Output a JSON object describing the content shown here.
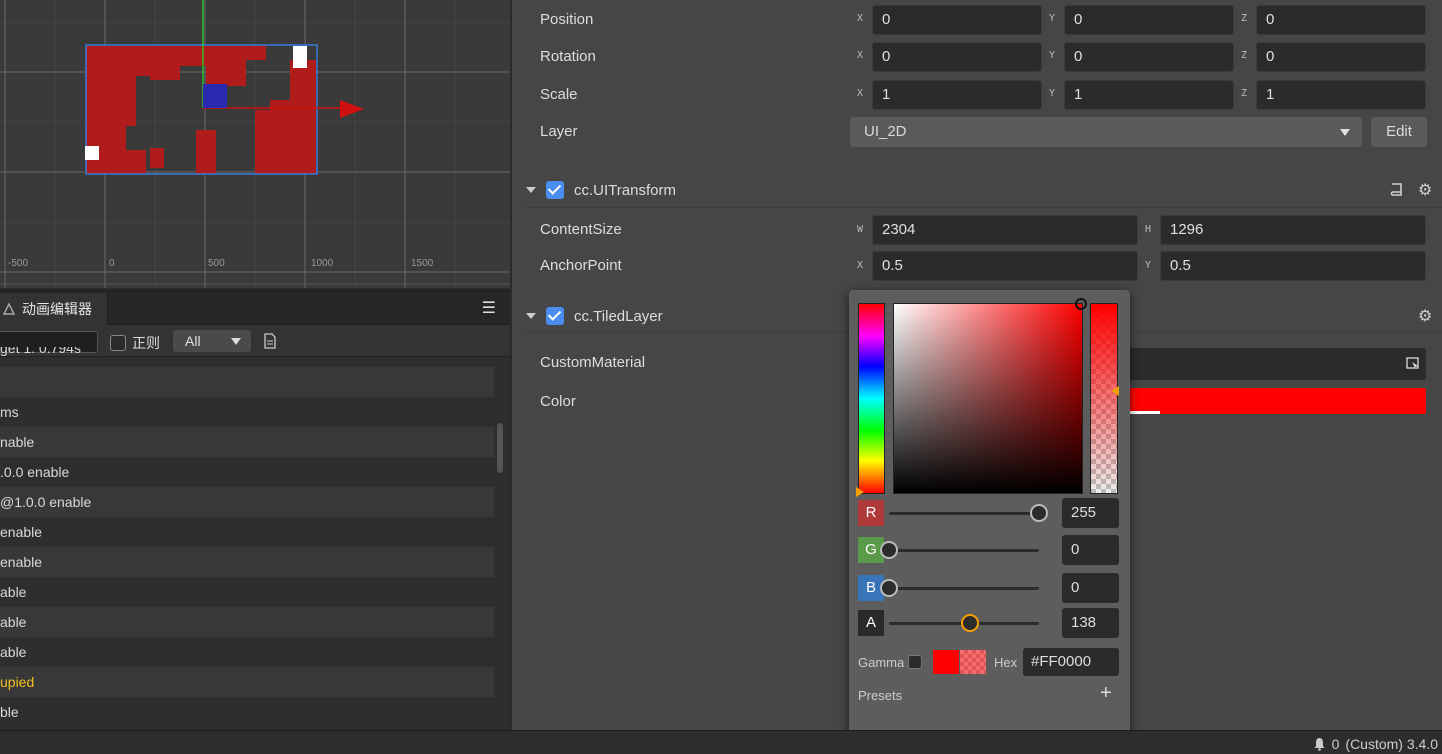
{
  "scene": {
    "ruler_labels": [
      "-500",
      "0",
      "500",
      "1000",
      "1500"
    ]
  },
  "anim_panel": {
    "tab_label": "动画编辑器",
    "menu_icon": "hamburger-icon",
    "filter_check_label": "正则",
    "filter_select": "All",
    "rows": [
      {
        "text": "get 1: 0.794s",
        "style": "normal"
      },
      {
        "text": "",
        "style": "alt"
      },
      {
        "text": "ms",
        "style": "normal"
      },
      {
        "text": "nable",
        "style": "alt"
      },
      {
        "text": ".0.0 enable",
        "style": "normal"
      },
      {
        "text": "@1.0.0 enable",
        "style": "alt"
      },
      {
        "text": "enable",
        "style": "normal"
      },
      {
        "text": "enable",
        "style": "alt"
      },
      {
        "text": "able",
        "style": "normal"
      },
      {
        "text": "able",
        "style": "alt"
      },
      {
        "text": "able",
        "style": "normal"
      },
      {
        "text": "upied",
        "style": "alt warn"
      },
      {
        "text": "ble",
        "style": "normal"
      }
    ]
  },
  "inspector": {
    "position": {
      "label": "Position",
      "x": "0",
      "y": "0",
      "z": "0"
    },
    "rotation": {
      "label": "Rotation",
      "x": "0",
      "y": "0",
      "z": "0"
    },
    "scale": {
      "label": "Scale",
      "x": "1",
      "y": "1",
      "z": "1"
    },
    "layer": {
      "label": "Layer",
      "value": "UI_2D",
      "edit_label": "Edit"
    },
    "axes": {
      "x": "X",
      "y": "Y",
      "z": "Z",
      "w": "W",
      "h": "H"
    },
    "ui_transform": {
      "title": "cc.UITransform",
      "content_size": {
        "label": "ContentSize",
        "w": "2304",
        "h": "1296"
      },
      "anchor_point": {
        "label": "AnchorPoint",
        "x": "0.5",
        "y": "0.5"
      }
    },
    "tiled_layer": {
      "title": "cc.TiledLayer",
      "custom_material_label": "CustomMaterial",
      "color_label": "Color",
      "color_value": "#ff0000"
    }
  },
  "color_picker": {
    "channels": [
      {
        "name": "R",
        "value": "255",
        "fraction": 1.0,
        "color": "#b03a3a"
      },
      {
        "name": "G",
        "value": "0",
        "fraction": 0.0,
        "color": "#5a9a4a"
      },
      {
        "name": "B",
        "value": "0",
        "fraction": 0.0,
        "color": "#3a74b8"
      },
      {
        "name": "A",
        "value": "138",
        "fraction": 0.54,
        "color": "#2a2a2a"
      }
    ],
    "gamma_label": "Gamma",
    "hex_label": "Hex",
    "hex_value": "#FF0000",
    "presets_label": "Presets",
    "presets_add": "+"
  },
  "status_bar": {
    "notification_count": "0",
    "version_text": "(Custom) 3.4.0"
  }
}
